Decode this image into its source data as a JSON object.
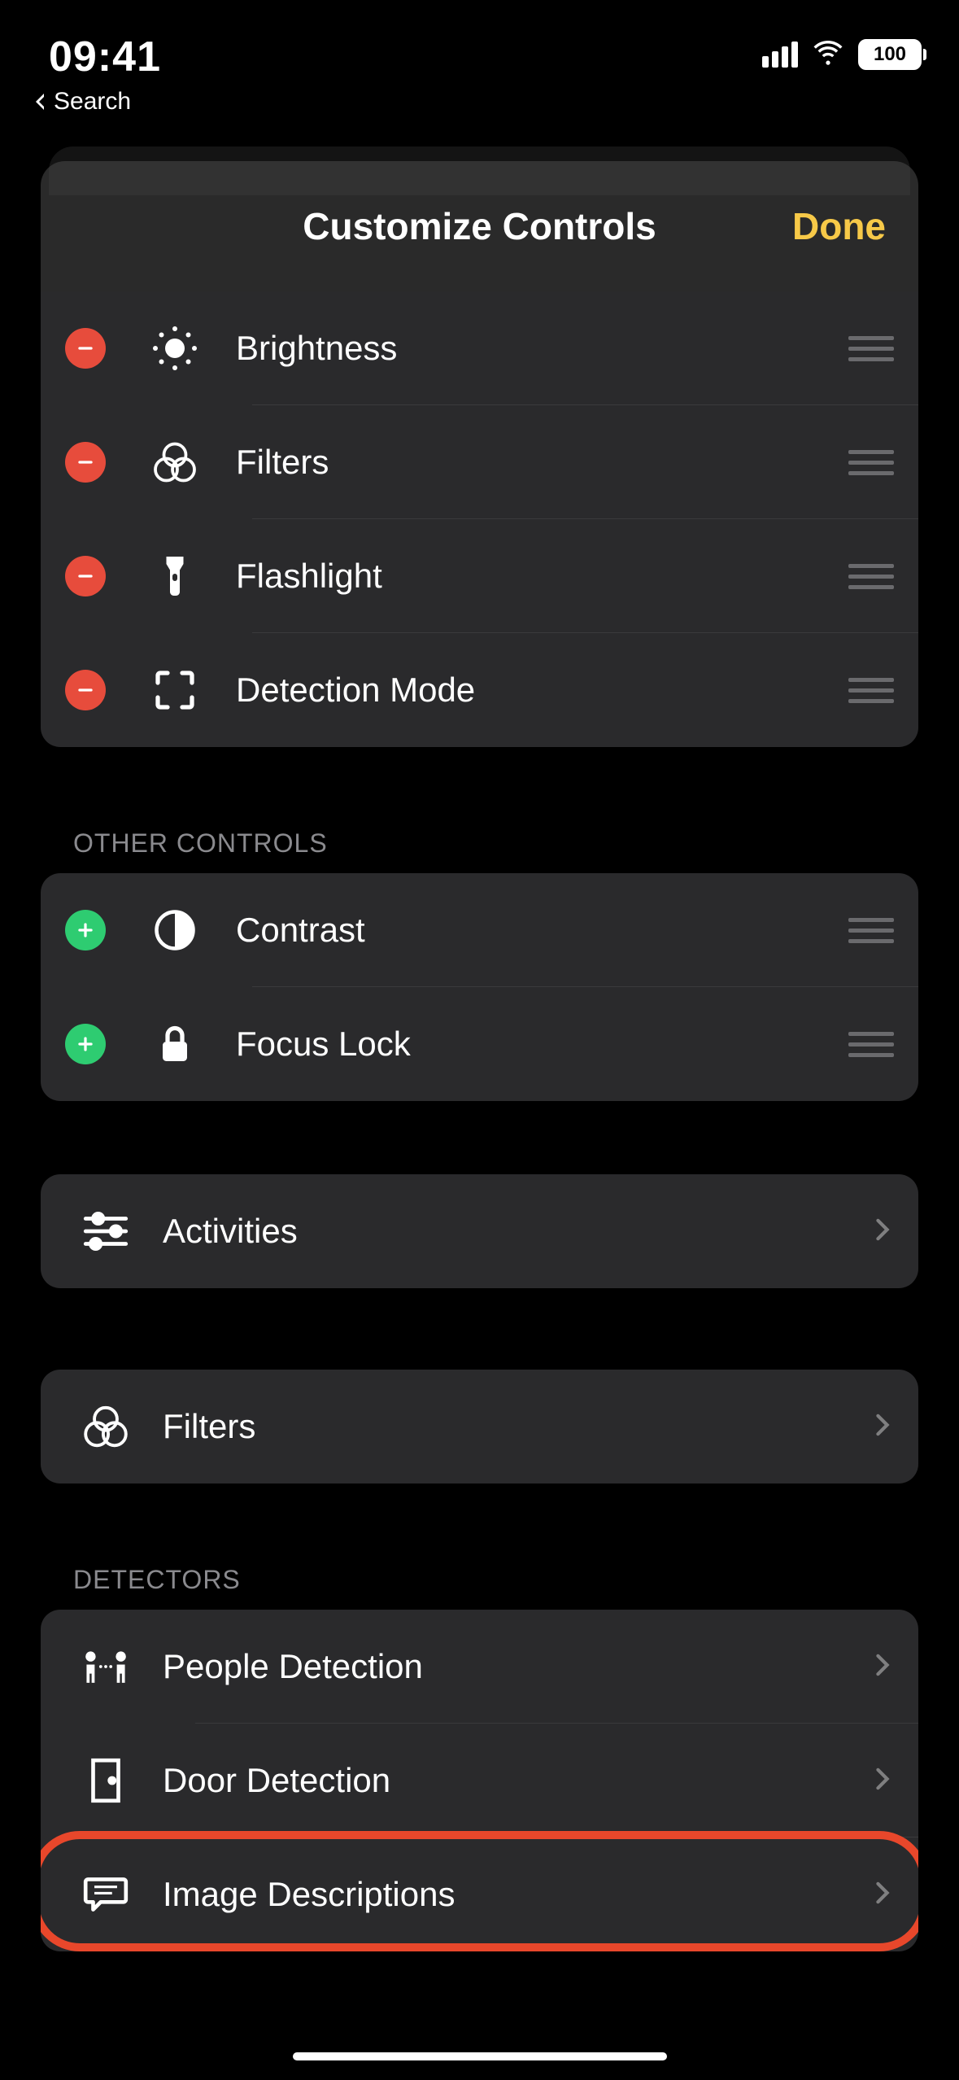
{
  "status_bar": {
    "time": "09:41",
    "battery_text": "100",
    "back_label": "Search"
  },
  "sheet": {
    "title": "Customize Controls",
    "done_label": "Done"
  },
  "included_controls": [
    {
      "id": "brightness",
      "label": "Brightness"
    },
    {
      "id": "filters",
      "label": "Filters"
    },
    {
      "id": "flashlight",
      "label": "Flashlight"
    },
    {
      "id": "detection-mode",
      "label": "Detection Mode"
    }
  ],
  "sections": {
    "other_controls_header": "OTHER CONTROLS",
    "detectors_header": "DETECTORS"
  },
  "other_controls": [
    {
      "id": "contrast",
      "label": "Contrast"
    },
    {
      "id": "focus-lock",
      "label": "Focus Lock"
    }
  ],
  "nav_items_1": [
    {
      "id": "activities",
      "label": "Activities"
    }
  ],
  "nav_items_2": [
    {
      "id": "filters-nav",
      "label": "Filters"
    }
  ],
  "detectors": [
    {
      "id": "people-detection",
      "label": "People Detection"
    },
    {
      "id": "door-detection",
      "label": "Door Detection"
    },
    {
      "id": "image-descriptions",
      "label": "Image Descriptions"
    }
  ]
}
